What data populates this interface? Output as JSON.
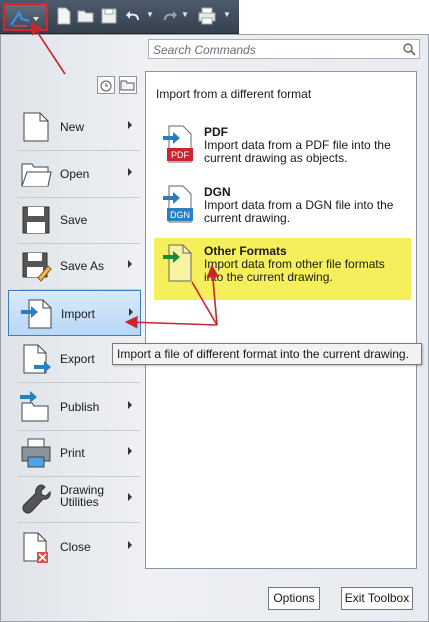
{
  "search": {
    "placeholder": "Search Commands"
  },
  "menu": {
    "items": [
      {
        "label": "New",
        "icon": "new-file-icon",
        "submenu": true
      },
      {
        "label": "Open",
        "icon": "folder-open-icon",
        "submenu": true
      },
      {
        "label": "Save",
        "icon": "save-icon",
        "submenu": false
      },
      {
        "label": "Save As",
        "icon": "save-as-icon",
        "submenu": true
      },
      {
        "label": "Import",
        "icon": "import-icon",
        "submenu": true,
        "selected": true
      },
      {
        "label": "Export",
        "icon": "export-icon",
        "submenu": false
      },
      {
        "label": "Publish",
        "icon": "publish-icon",
        "submenu": true
      },
      {
        "label": "Print",
        "icon": "printer-icon",
        "submenu": true
      },
      {
        "label": "Drawing\nUtilities",
        "label_line1": "Drawing",
        "label_line2": "Utilities",
        "icon": "wrench-icon",
        "submenu": true
      },
      {
        "label": "Close",
        "icon": "close-file-icon",
        "submenu": true
      }
    ]
  },
  "panel": {
    "title": "Import from a different format",
    "items": [
      {
        "title": "PDF",
        "description": "Import data from a PDF file into the current drawing as objects.",
        "icon": "pdf-file-icon",
        "badge": "PDF"
      },
      {
        "title": "DGN",
        "description": "Import data from a DGN file into the current drawing.",
        "icon": "dgn-file-icon",
        "badge": "DGN"
      },
      {
        "title": "Other Formats",
        "description": "Import data from other file formats into the current drawing.",
        "icon": "generic-file-import-icon",
        "highlighted": true
      }
    ]
  },
  "tooltip": {
    "text": "Import a file of different format into the current drawing."
  },
  "buttons": {
    "options": "Options",
    "exit": "Exit Toolbox"
  },
  "colors": {
    "annotation_red": "#c8262c",
    "highlight_yellow": "#f4ef5a",
    "selection_blue": "#3d7cc4",
    "pdf_red": "#c8262c",
    "dgn_blue": "#2a7fc1",
    "import_arrow_blue": "#2a7fc1",
    "import_arrow_green": "#1a8a3c"
  }
}
